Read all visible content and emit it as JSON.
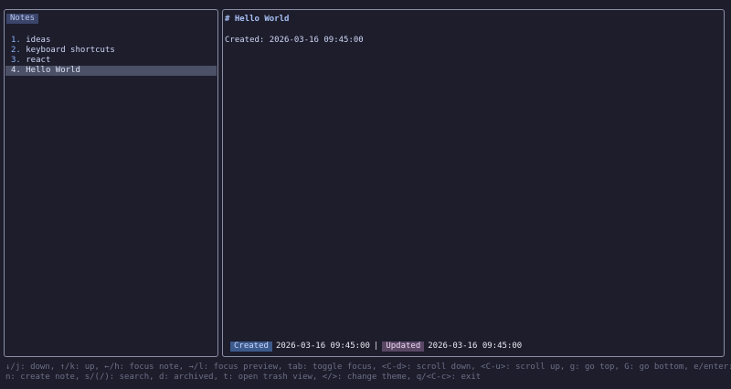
{
  "list_pane": {
    "title": "Notes",
    "items": [
      {
        "num": "1.",
        "name": "ideas"
      },
      {
        "num": "2.",
        "name": "keyboard shortcuts"
      },
      {
        "num": "3.",
        "name": "react"
      },
      {
        "num": "4.",
        "name": "Hello World"
      }
    ],
    "selected_index": 3
  },
  "preview_pane": {
    "heading": "# Hello World",
    "body": "Created: 2026-03-16 09:45:00",
    "meta": {
      "created_label": "Created",
      "created_value": "2026-03-16 09:45:00",
      "separator": "|",
      "updated_label": "Updated",
      "updated_value": "2026-03-16 09:45:00"
    }
  },
  "help": {
    "line1": "↓/j: down, ↑/k: up, ←/h: focus note, →/l: focus preview, tab: toggle focus, <C-d>: scroll down, <C-u>: scroll up, g: go top, G: go bottom, e/enter: edit,",
    "line2": "n: create note, s/(/): search, d: archived, t: open trash view, </>: change theme, q/<C-c>: exit"
  },
  "colors": {
    "background": "#1d1d2c",
    "border": "#8a8fa6",
    "title_badge": "#3c466b",
    "selection": "#4b5066",
    "created_badge": "#3c5a8c",
    "updated_badge": "#5a4766",
    "help_text": "#6c7086"
  }
}
